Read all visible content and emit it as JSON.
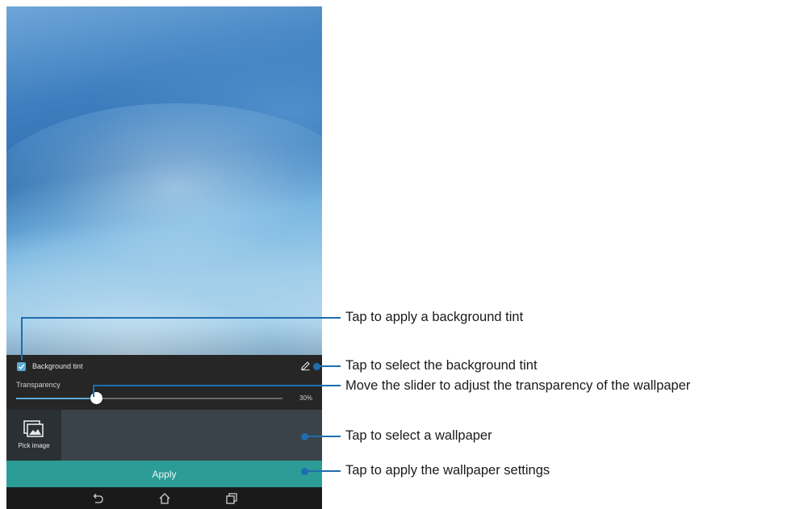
{
  "screen": {
    "tint_checkbox": {
      "label": "Background tint",
      "checked": true
    },
    "transparency": {
      "label": "Transparency",
      "value_text": "30%",
      "value_percent": 30
    },
    "picker": {
      "pick_label": "Pick image"
    },
    "apply_label": "Apply",
    "nav": {
      "back": "back-icon",
      "home": "home-icon",
      "recents": "recent-apps-icon"
    }
  },
  "callouts": [
    {
      "text": "Tap to apply a background tint"
    },
    {
      "text": "Tap to select the background tint"
    },
    {
      "text": "Move the slider to adjust the transparency of the wallpaper"
    },
    {
      "text": "Tap to select a wallpaper"
    },
    {
      "text": "Tap to apply the wallpaper settings"
    }
  ],
  "colors": {
    "accent": "#5aaad6",
    "apply": "#2c9c96",
    "callout": "#1f6db0"
  }
}
